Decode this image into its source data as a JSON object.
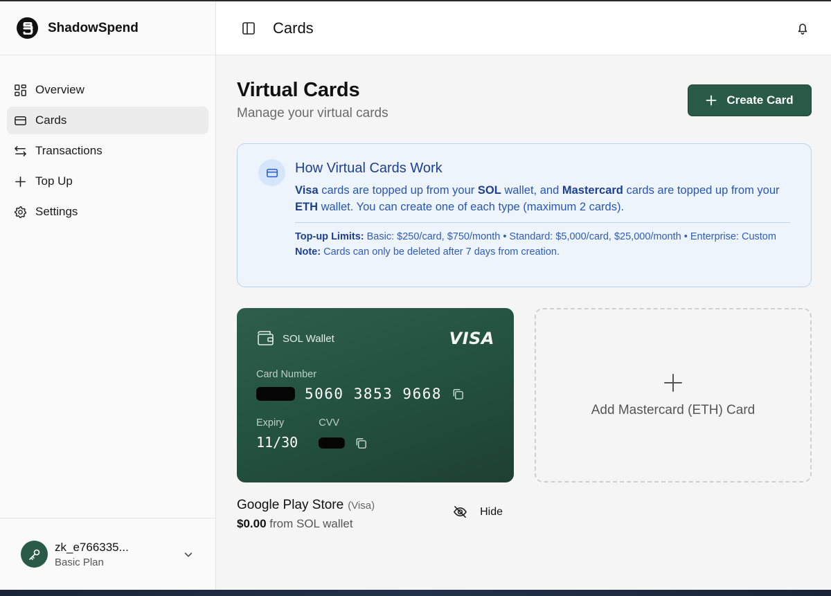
{
  "brand": {
    "name": "ShadowSpend"
  },
  "sidebar": {
    "items": [
      {
        "label": "Overview",
        "icon": "grid-icon"
      },
      {
        "label": "Cards",
        "icon": "credit-card-icon",
        "active": true
      },
      {
        "label": "Transactions",
        "icon": "arrows-exchange-icon"
      },
      {
        "label": "Top Up",
        "icon": "plus-icon"
      },
      {
        "label": "Settings",
        "icon": "gear-icon"
      }
    ],
    "user": {
      "name": "zk_e766335...",
      "plan": "Basic Plan"
    }
  },
  "topbar": {
    "title": "Cards"
  },
  "page": {
    "title": "Virtual Cards",
    "subtitle": "Manage your virtual cards",
    "create_label": "Create Card"
  },
  "info": {
    "title": "How Virtual Cards Work",
    "text": {
      "visa": "Visa",
      "p1": " cards are topped up from your ",
      "sol": "SOL",
      "p2": " wallet, and ",
      "mastercard": "Mastercard",
      "p3": " cards are topped up from your ",
      "eth": "ETH",
      "p4": " wallet. You can create one of each type (maximum 2 cards)."
    },
    "limits_label": "Top-up Limits:",
    "limits_text": " Basic: $250/card, $750/month • Standard: $5,000/card, $25,000/month • Enterprise: Custom",
    "note_label": "Note:",
    "note_text": " Cards can only be deleted after 7 days from creation."
  },
  "card": {
    "wallet_label": "SOL Wallet",
    "network": "VISA",
    "number_label": "Card Number",
    "number_visible": "5060 3853 9668",
    "expiry_label": "Expiry",
    "expiry": "11/30",
    "cvv_label": "CVV",
    "name": "Google Play Store",
    "type": "(Visa)",
    "balance": "$0.00",
    "balance_suffix": " from SOL wallet",
    "hide_label": "Hide"
  },
  "add_card": {
    "label": "Add Mastercard (ETH) Card"
  },
  "colors": {
    "accent": "#2a5a48",
    "info_bg": "#eef4fc",
    "info_text": "#2956b3"
  }
}
